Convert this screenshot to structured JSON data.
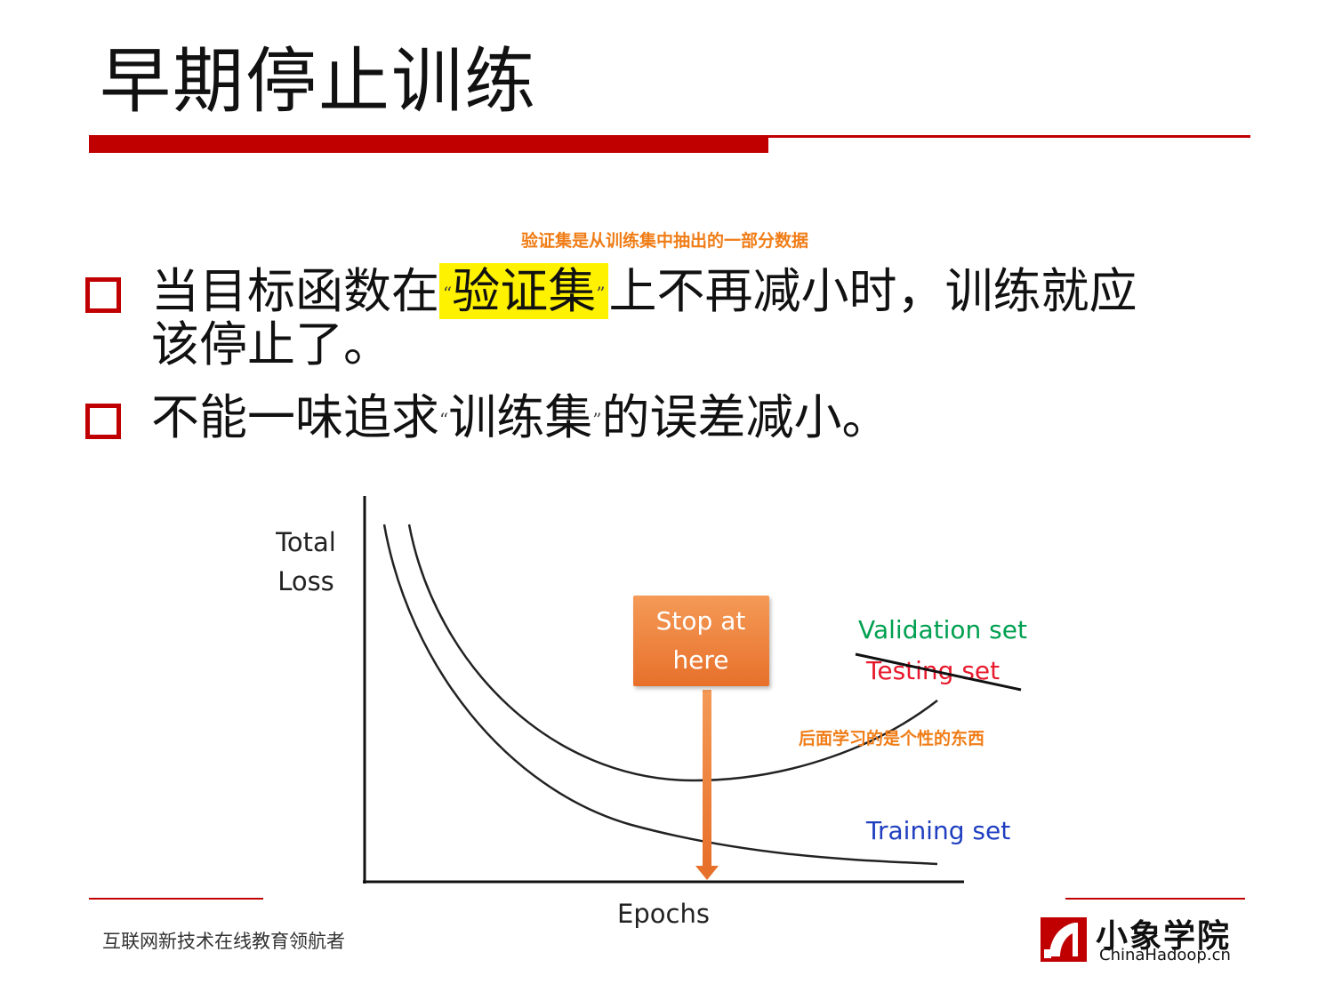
{
  "slide": {
    "title": "早期停止训练"
  },
  "annotations": {
    "top": "验证集是从训练集中抽出的一部分数据",
    "curve": "后面学习的是个性的东西"
  },
  "bullets": [
    {
      "before": "当目标函数在",
      "open_quote": "“",
      "highlight": "验证集",
      "close_quote": "”",
      "after": "上不再减小时，训练就应",
      "line2": "该停止了。"
    },
    {
      "before": "不能一味追求",
      "open_quote": "“",
      "highlight": "训练集",
      "close_quote": "”",
      "after": "的误差减小。"
    }
  ],
  "chart_data": {
    "type": "line",
    "ylabel_line1": "Total",
    "ylabel_line2": "Loss",
    "xlabel": "Epochs",
    "series": [
      {
        "name": "Validation set",
        "color": "#00a050"
      },
      {
        "name": "Testing set",
        "color": "#e8192c",
        "struck_through": true
      },
      {
        "name": "Training set",
        "color": "#1f3fc0"
      }
    ],
    "callout": "Stop at here",
    "callout_line1": "Stop at",
    "callout_line2": "here",
    "callout_color": "#ef7b2f"
  },
  "footer": {
    "org_text": "互联网新技术在线教育领航者",
    "brand_name": "小象学院",
    "brand_url": "ChinaHadoop.cn",
    "accent": "#c00000"
  }
}
